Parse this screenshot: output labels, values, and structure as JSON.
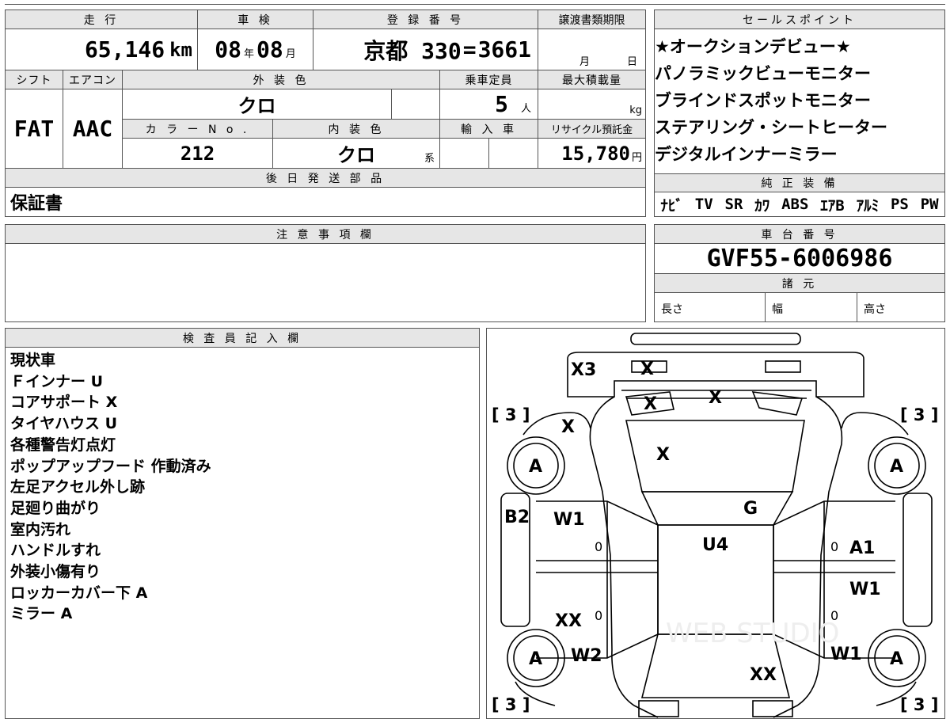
{
  "top": {
    "headers": {
      "mileage": "走 行",
      "inspection": "車 検",
      "registration": "登 録 番 号",
      "transfer": "譲渡書類期限",
      "shift": "シフト",
      "aircon": "エアコン",
      "ext_color": "外 装 色",
      "capacity": "乗車定員",
      "max_load": "最大積載量",
      "color_no": "カ ラ ー N o .",
      "int_color": "内 装 色",
      "import": "輸 入 車",
      "recycle": "リサイクル預託金",
      "later_parts": "後 日 発 送 部 品"
    },
    "mileage_value": "65,146",
    "mileage_unit": "km",
    "inspection_year": "08",
    "inspection_year_unit": "年",
    "inspection_month": "08",
    "inspection_month_unit": "月",
    "registration_value": "京都 330",
    "registration_number": "3661",
    "transfer_month_unit": "月",
    "transfer_day_unit": "日",
    "shift_value": "FAT",
    "aircon_value": "AAC",
    "ext_color_value": "クロ",
    "capacity_value": "5",
    "capacity_unit": "人",
    "max_load_unit": "kg",
    "color_no_value": "212",
    "int_color_value": "クロ",
    "int_color_suffix": "系",
    "recycle_value": "15,780",
    "recycle_unit": "円",
    "later_parts_value": "保証書"
  },
  "sales": {
    "header": "セールスポイント",
    "points": [
      "★オークションデビュー★",
      "パノラミックビューモニター",
      "ブラインドスポットモニター",
      "ステアリング・シートヒーター",
      "デジタルインナーミラー"
    ]
  },
  "equipment": {
    "header": "純 正 装 備",
    "items": [
      "ﾅﾋﾞ",
      "TV",
      "SR",
      "ｶﾜ",
      "ABS",
      "ｴｱB",
      "ｱﾙﾐ",
      "PS",
      "PW"
    ]
  },
  "caution": {
    "header": "注 意 事 項 欄"
  },
  "chassis": {
    "header": "車 台 番 号",
    "value": "GVF55-6006986",
    "spec_header": "諸 元",
    "length_label": "長さ",
    "width_label": "幅",
    "height_label": "高さ"
  },
  "inspector": {
    "header": "検 査 員 記 入 欄",
    "notes": [
      "現状車",
      "Ｆインナー U",
      "コアサポート X",
      "タイヤハウス U",
      "各種警告灯点灯",
      "ポップアップフード 作動済み",
      "左足アクセル外し跡",
      "足廻り曲がり",
      "室内汚れ",
      "ハンドルすれ",
      "外装小傷有り",
      "ロッカーカバー下 A",
      "ミラー A"
    ]
  },
  "diagram": {
    "marks": {
      "front_bumper": "X3",
      "grille": "X",
      "headlight_left": "X",
      "headlight_right": "X",
      "fender_front_left": "X",
      "hood": "X",
      "windshield": "G",
      "roof": "U4",
      "front_door_left": "W1",
      "rear_door_left": "XX",
      "quarter_left": "W2",
      "pillar_left": "B2",
      "front_door_right": "A1",
      "rear_door_right": "W1",
      "quarter_right": "W1",
      "trunk": "XX",
      "wheel_fl": "A",
      "wheel_fr": "A",
      "wheel_rl": "A",
      "wheel_rr": "A",
      "door_l1_zero": "0",
      "door_l2_zero": "0",
      "door_r1_zero": "0",
      "door_r2_zero": "0",
      "bracket_fl": "[ 3 ]",
      "bracket_fr": "[ 3 ]",
      "bracket_rl": "[ 3 ]",
      "bracket_rr": "[ 3 ]",
      "watermark": "WEB STUDIO"
    }
  }
}
